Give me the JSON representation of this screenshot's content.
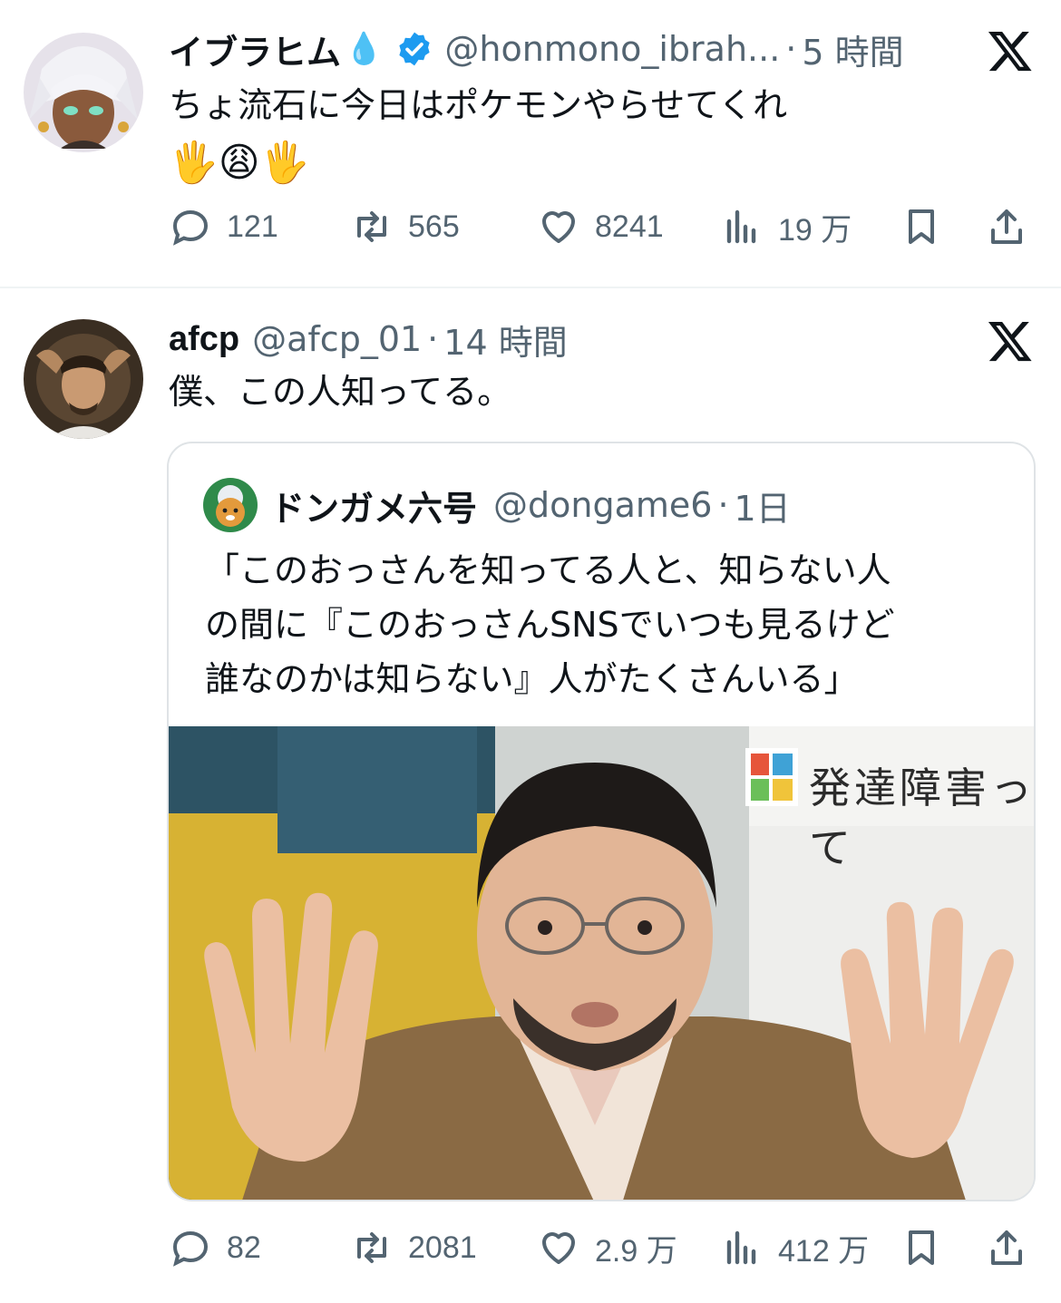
{
  "tweet1": {
    "name": "イブラヒム",
    "name_emoji": "💧",
    "handle": "@honmono_ibrah...",
    "separator": "·",
    "time": "5 時間",
    "text_line1": "ちょ流石に今日はポケモンやらせてくれ",
    "text_line2": "🖐️😩🖐️",
    "verified_icon": "verified-badge-icon",
    "stats": {
      "replies": "121",
      "retweets": "565",
      "likes": "8241",
      "views": "19 万"
    }
  },
  "tweet2": {
    "name": "afcp",
    "handle": "@afcp_01",
    "separator": "·",
    "time": "14 時間",
    "text": "僕、この人知ってる。",
    "quote": {
      "name": "ドンガメ六号",
      "handle": "@dongame6",
      "separator": "·",
      "time": "1日",
      "text_line1": "「このおっさんを知ってる人と、知らない人",
      "text_line2": "の間に『このおっさんSNSでいつも見るけど",
      "text_line3": "誰なのかは知らない』人がたくさんいる」",
      "image_caption": "発達障害って"
    },
    "stats": {
      "replies": "82",
      "retweets": "2081",
      "likes": "2.9 万",
      "views": "412 万"
    }
  },
  "colors": {
    "text": "#0f1419",
    "secondary": "#536471",
    "verified": "#1d9bf0",
    "divider": "#eff3f4"
  }
}
